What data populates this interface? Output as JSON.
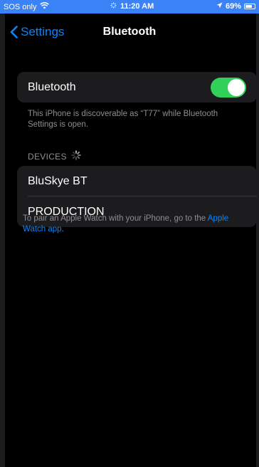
{
  "status_bar": {
    "carrier": "SOS only",
    "time": "11:20 AM",
    "battery": "69%"
  },
  "nav": {
    "back_label": "Settings",
    "title": "Bluetooth"
  },
  "bluetooth": {
    "label": "Bluetooth",
    "enabled": true,
    "discoverable_note": "This iPhone is discoverable as “T77” while Bluetooth Settings is open."
  },
  "devices": {
    "header": "DEVICES",
    "items": [
      {
        "name": "BluSkye BT"
      },
      {
        "name": "PRODUCTION"
      }
    ]
  },
  "pair_note": {
    "text": "To pair an Apple Watch with your iPhone, go to the",
    "link": "Apple Watch app",
    "suffix": "."
  },
  "colors": {
    "accent": "#0a84ff",
    "toggle_on": "#30d158",
    "status_bar": "#3b82f6"
  }
}
